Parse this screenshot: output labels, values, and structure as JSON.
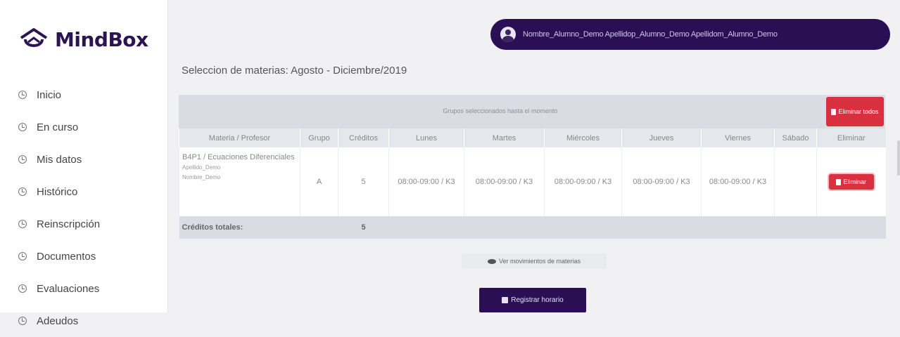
{
  "brand": {
    "name": "MindBox"
  },
  "sidebar": {
    "items": [
      {
        "label": "Inicio"
      },
      {
        "label": "En curso"
      },
      {
        "label": "Mis datos"
      },
      {
        "label": "Histórico"
      },
      {
        "label": "Reinscripción"
      },
      {
        "label": "Documentos"
      },
      {
        "label": "Evaluaciones"
      },
      {
        "label": "Adeudos"
      }
    ]
  },
  "user": {
    "name": "Nombre_Alumno_Demo Apellidop_Alumno_Demo Apellidom_Alumno_Demo"
  },
  "page": {
    "title": "Seleccion de materias: Agosto - Diciembre/2019"
  },
  "table": {
    "caption": "Grupos seleccionados hasta el momento",
    "delete_all_label": "Eliminar todos",
    "headers": [
      "Materia / Profesor",
      "Grupo",
      "Créditos",
      "Lunes",
      "Martes",
      "Miércoles",
      "Jueves",
      "Viernes",
      "Sábado",
      "Eliminar"
    ],
    "rows": [
      {
        "materia": "B4P1 / Ecuaciones Diferenciales",
        "profesor_apellido": "Apellido_Demo",
        "profesor_nombre": "Nombre_Demo",
        "grupo": "A",
        "creditos": "5",
        "lunes": "08:00-09:00 / K3",
        "martes": "08:00-09:00 / K3",
        "miercoles": "08:00-09:00 / K3",
        "jueves": "08:00-09:00 / K3",
        "viernes": "08:00-09:00 / K3",
        "sabado": "",
        "delete_label": "Eliminar"
      }
    ],
    "total_label": "Créditos totales:",
    "total_value": "5"
  },
  "actions": {
    "movements_label": "Ver movimientos de materias",
    "register_label": "Registrar horario"
  },
  "colors": {
    "brand_dark": "#2a0f55",
    "danger": "#d8303f",
    "table_header": "#d9dde3"
  }
}
